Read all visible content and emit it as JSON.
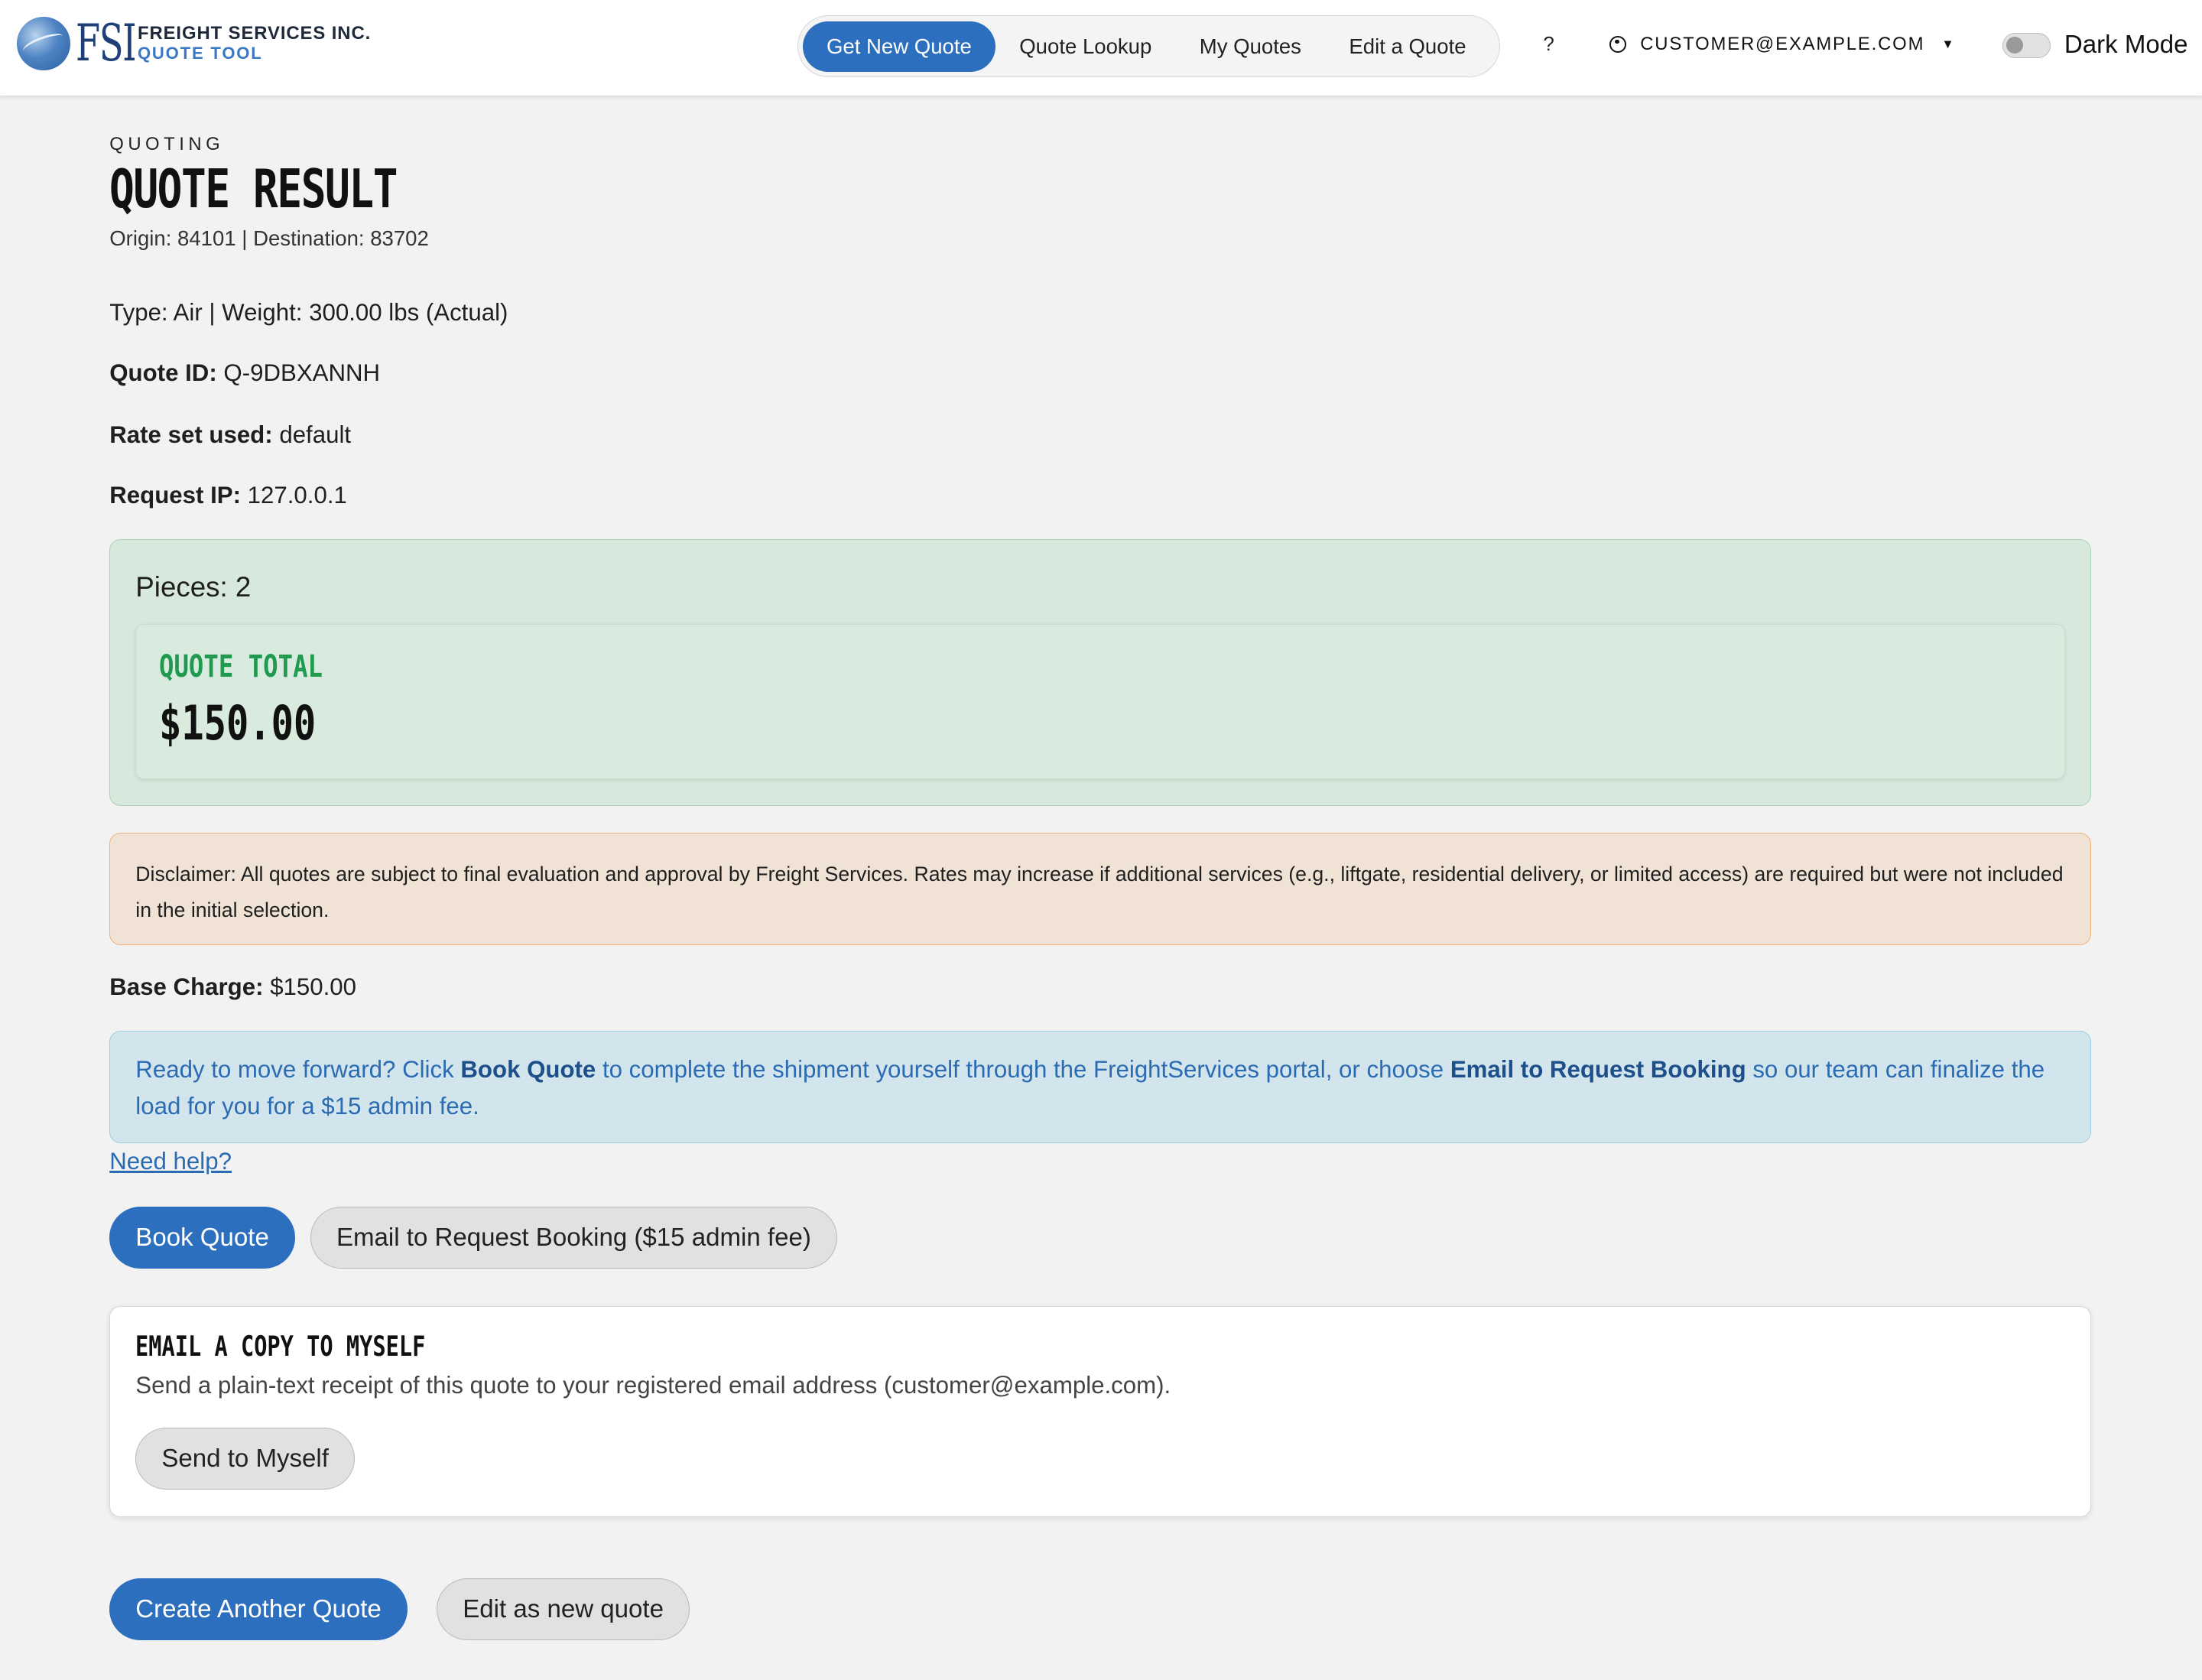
{
  "header": {
    "logo_text": "FSI",
    "company_name": "FREIGHT SERVICES INC.",
    "tool_name": "QUOTE TOOL",
    "tabs": [
      {
        "label": "Get New Quote"
      },
      {
        "label": "Quote Lookup"
      },
      {
        "label": "My Quotes"
      },
      {
        "label": "Edit a Quote"
      }
    ],
    "help_label": "?",
    "user_email": "CUSTOMER@EXAMPLE.COM",
    "dark_mode_label": "Dark Mode",
    "dark_mode_on": false
  },
  "page": {
    "eyebrow": "QUOTING",
    "title": "QUOTE RESULT",
    "route": "Origin: 84101 | Destination: 83702",
    "type_weight": "Type: Air | Weight: 300.00 lbs (Actual)",
    "quote_id_label": "Quote ID:",
    "quote_id_value": " Q-9DBXANNH",
    "rate_set_label": "Rate set used:",
    "rate_set_value": " default",
    "request_ip_label": "Request IP:",
    "request_ip_value": " 127.0.0.1"
  },
  "summary": {
    "pieces": "Pieces: 2",
    "total_label": "QUOTE TOTAL",
    "total_value": "$150.00"
  },
  "disclaimer": "Disclaimer: All quotes are subject to final evaluation and approval by Freight Services. Rates may increase if additional services (e.g., liftgate, residential delivery, or limited access) are required but were not included in the initial selection.",
  "base_charge_label": "Base Charge:",
  "base_charge_value": " $150.00",
  "booking_note": {
    "part1": "Ready to move forward? Click ",
    "book_bold": "Book Quote",
    "part2": " to complete the shipment yourself through the FreightServices portal, or choose ",
    "email_bold": "Email to Request Booking",
    "part3": " so our team can finalize the load for you for a $15 admin fee."
  },
  "need_help": "Need help?",
  "buttons": {
    "book": "Book Quote",
    "email_request": "Email to Request Booking ($15 admin fee)",
    "send_myself": "Send to Myself",
    "create_another": "Create Another Quote",
    "edit_new": "Edit as new quote"
  },
  "email_copy": {
    "heading": "EMAIL A COPY TO MYSELF",
    "description": "Send a plain-text receipt of this quote to your registered email address (customer@example.com)."
  }
}
